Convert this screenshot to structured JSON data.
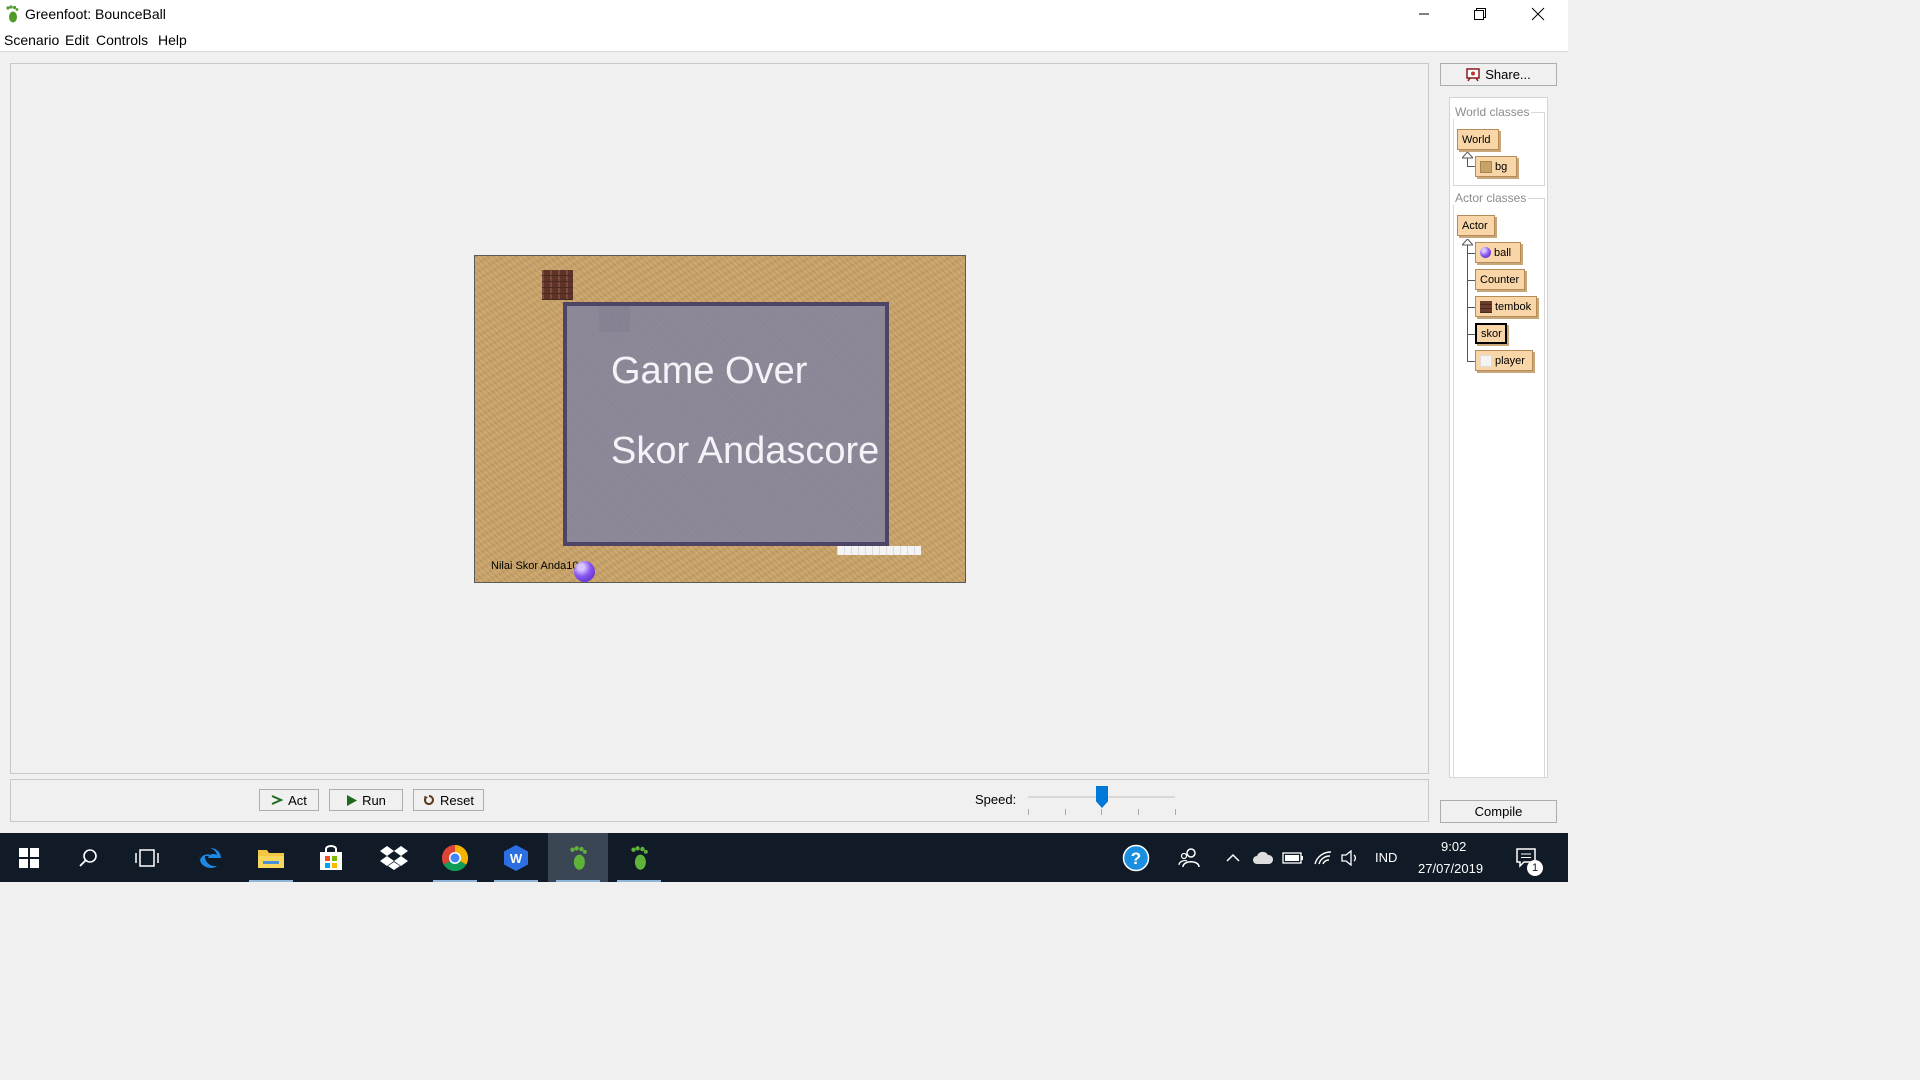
{
  "window": {
    "title": "Greenfoot: BounceBall"
  },
  "menu": [
    "Scenario",
    "Edit",
    "Controls",
    "Help"
  ],
  "world": {
    "overlay_line1": "Game Over",
    "overlay_line2": "Skor Andascore",
    "score_text": "Nilai Skor Anda10"
  },
  "sidebar": {
    "share_label": "Share...",
    "world_classes_label": "World classes",
    "world_classes": [
      "World",
      "bg"
    ],
    "actor_classes_label": "Actor classes",
    "actor_classes": [
      "Actor",
      "ball",
      "Counter",
      "tembok",
      "skor",
      "player"
    ],
    "compile_label": "Compile"
  },
  "controls": {
    "act_label": "Act",
    "run_label": "Run",
    "reset_label": "Reset",
    "speed_label": "Speed:",
    "speed_value": 0.5
  },
  "taskbar": {
    "language": "IND",
    "time": "9:02",
    "date": "27/07/2019",
    "notification_count": "1"
  },
  "colors": {
    "class_box": "#f8d6a8",
    "world_bg": "#c9a267",
    "overlay": "#8282a0",
    "taskbar": "#101b27",
    "accent": "#0078d7"
  }
}
